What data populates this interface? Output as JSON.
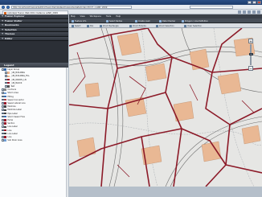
{
  "browser": {
    "address": "http://localhost/mapguide2011/fusion/templates/mapguide/slate/index.html?...LAND_2009",
    "tab_title": "Autodesk Fusion Web 2011 Instance LAND_2009"
  },
  "app": {
    "panels": [
      "Fusion Explorer",
      "Fusion Visitor",
      "Bookmarks",
      "Selection",
      "Themes",
      "Editor"
    ],
    "legend_title": "Legend",
    "legend_items": [
      {
        "label": "Layer Group",
        "color": "#3366aa"
      },
      {
        "label": "_UN_BUILDING",
        "color": "#e8b48d"
      },
      {
        "label": "_UN_BUILDING_FILL",
        "color": "#e8b48d"
      },
      {
        "label": "_UN_PARCEL_LN",
        "color": "#9a1b2b"
      },
      {
        "label": "_UN_BLOCK",
        "color": "#9a1b2b"
      },
      {
        "label": "Text",
        "color": "#555555"
      },
      {
        "label": "Contours",
        "color": "#888888"
      },
      {
        "label": "Storm Area",
        "color": "#6f9fd8"
      },
      {
        "label": "Fitting",
        "color": "#3a6db0"
      },
      {
        "label": "Sewer Connector",
        "color": "#b04040"
      },
      {
        "label": "Sewer Lateral Line",
        "color": "#9a1b2b"
      },
      {
        "label": "Manhole",
        "color": "#444444"
      },
      {
        "label": "Manhole Label",
        "color": "#444444"
      },
      {
        "label": "Pipe Label",
        "color": "#444444"
      },
      {
        "label": "Storm Sewer Flow",
        "color": "#3a6db0"
      },
      {
        "label": "Pump",
        "color": "#9a1b2b"
      },
      {
        "label": "Section",
        "color": "#9a1b2b"
      },
      {
        "label": "Line Label",
        "color": "#444444"
      },
      {
        "label": "Line",
        "color": "#9a1b2b"
      },
      {
        "label": "Line Label",
        "color": "#444444"
      },
      {
        "label": "Line",
        "color": "#9a1b2b"
      },
      {
        "label": "Sub Drain Area",
        "color": "#6f9fd8"
      }
    ],
    "menu": [
      "Map",
      "View",
      "Workspace",
      "Tools",
      "Help"
    ],
    "toolbar": [
      "Feature Info",
      "Select Radius",
      "Create Load",
      "Data Checker",
      "Polygon / Line Definition"
    ],
    "toolbar2": [
      "Select",
      "Pan",
      "Zoom Rectangle",
      "Zoom Extents",
      "Zoom Selection",
      "Clear Selection"
    ]
  },
  "colors": {
    "parcel": "#8c1a28",
    "building": "#e9b894",
    "background": "#e6e6e4",
    "road_edge": "#6d6d6d"
  }
}
